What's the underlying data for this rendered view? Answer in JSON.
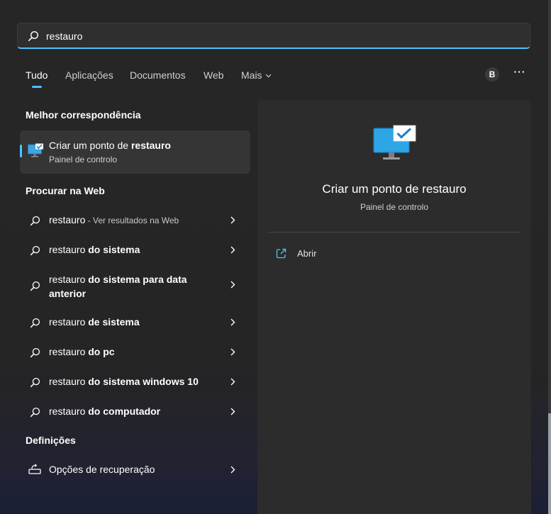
{
  "search": {
    "value": "restauro"
  },
  "tabs": [
    {
      "label": "Tudo"
    },
    {
      "label": "Aplicações"
    },
    {
      "label": "Documentos"
    },
    {
      "label": "Web"
    },
    {
      "label": "Mais"
    }
  ],
  "user": {
    "initial": "B"
  },
  "more_icon": "ellipsis-icon",
  "sections": {
    "best_match": "Melhor correspondência",
    "web": "Procurar na Web",
    "settings": "Definições"
  },
  "best_match": {
    "title_prefix": "Criar um ponto de ",
    "title_bold": "restauro",
    "subtitle": "Painel de controlo",
    "icon": "monitor-check-icon"
  },
  "web_results": [
    {
      "plain": "restauro",
      "bold": "",
      "sub": " - Ver resultados na Web"
    },
    {
      "plain": "restauro ",
      "bold": "do sistema",
      "sub": ""
    },
    {
      "plain": "restauro ",
      "bold": "do sistema para data anterior",
      "sub": ""
    },
    {
      "plain": "restauro ",
      "bold": "de sistema",
      "sub": ""
    },
    {
      "plain": "restauro ",
      "bold": "do pc",
      "sub": ""
    },
    {
      "plain": "restauro ",
      "bold": "do sistema windows 10",
      "sub": ""
    },
    {
      "plain": "restauro ",
      "bold": "do computador",
      "sub": ""
    }
  ],
  "settings_results": [
    {
      "label": "Opções de recuperação",
      "icon": "recovery-icon"
    }
  ],
  "detail": {
    "title": "Criar um ponto de restauro",
    "subtitle": "Painel de controlo",
    "actions": [
      {
        "label": "Abrir",
        "icon": "open-external-icon"
      }
    ]
  },
  "colors": {
    "accent": "#4cc2ff",
    "background": "#262626",
    "pane": "#2c2c2c",
    "selected": "#353535"
  }
}
